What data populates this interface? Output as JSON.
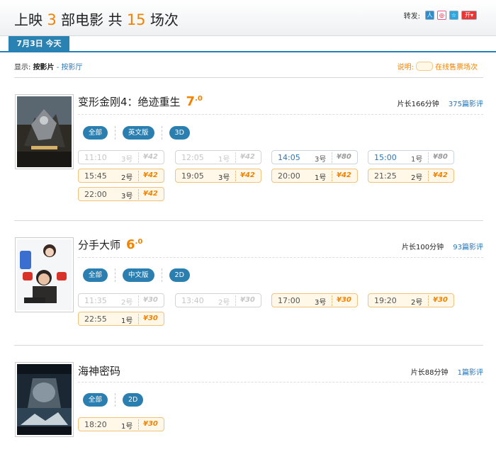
{
  "header": {
    "title_prefix": "上映",
    "movie_count": "3",
    "title_mid": "部电影 共",
    "show_count": "15",
    "title_suffix": "场次"
  },
  "share": {
    "label": "转发:",
    "icons": [
      "renren-icon",
      "weibo-icon",
      "qzone-icon",
      "more-share-icon"
    ]
  },
  "date_tab": {
    "label": "7月3日  今天"
  },
  "display": {
    "prefix": "显示:",
    "by_movie": "按影片",
    "sep": " - ",
    "by_hall": "按影厅",
    "legend_label": "说明:",
    "legend_text": "在线售票场次"
  },
  "colors": {
    "accent_blue": "#2a82b3",
    "orange": "#f08300",
    "online_bg": "#fff8e8",
    "online_border": "#f1c27c"
  },
  "movies": [
    {
      "name": "变形金刚4：绝迹重生",
      "rating_int": "7",
      "rating_dec": ".0",
      "length": "片长166分钟",
      "reviews": "375篇影评",
      "filters": [
        "全部",
        "英文版",
        "3D"
      ],
      "showtimes": [
        {
          "time": "11:10",
          "hall": "3号",
          "price": "¥42",
          "status": "disabled"
        },
        {
          "time": "12:05",
          "hall": "1号",
          "price": "¥42",
          "status": "disabled"
        },
        {
          "time": "14:05",
          "hall": "3号",
          "price": "¥80",
          "status": "normal"
        },
        {
          "time": "15:00",
          "hall": "1号",
          "price": "¥80",
          "status": "normal"
        },
        {
          "time": "15:45",
          "hall": "2号",
          "price": "¥42",
          "status": "online"
        },
        {
          "time": "19:05",
          "hall": "3号",
          "price": "¥42",
          "status": "online"
        },
        {
          "time": "20:00",
          "hall": "1号",
          "price": "¥42",
          "status": "online"
        },
        {
          "time": "21:25",
          "hall": "2号",
          "price": "¥42",
          "status": "online"
        },
        {
          "time": "22:00",
          "hall": "3号",
          "price": "¥42",
          "status": "online"
        }
      ]
    },
    {
      "name": "分手大师",
      "rating_int": "6",
      "rating_dec": ".0",
      "length": "片长100分钟",
      "reviews": "93篇影评",
      "filters": [
        "全部",
        "中文版",
        "2D"
      ],
      "showtimes": [
        {
          "time": "11:35",
          "hall": "2号",
          "price": "¥30",
          "status": "disabled"
        },
        {
          "time": "13:40",
          "hall": "2号",
          "price": "¥30",
          "status": "disabled"
        },
        {
          "time": "17:00",
          "hall": "3号",
          "price": "¥30",
          "status": "online"
        },
        {
          "time": "19:20",
          "hall": "2号",
          "price": "¥30",
          "status": "online"
        },
        {
          "time": "22:55",
          "hall": "1号",
          "price": "¥30",
          "status": "online"
        }
      ]
    },
    {
      "name": "海神密码",
      "rating_int": "",
      "rating_dec": "",
      "length": "片长88分钟",
      "reviews": "1篇影评",
      "filters": [
        "全部",
        "2D"
      ],
      "showtimes": [
        {
          "time": "18:20",
          "hall": "1号",
          "price": "¥30",
          "status": "online"
        }
      ]
    }
  ]
}
